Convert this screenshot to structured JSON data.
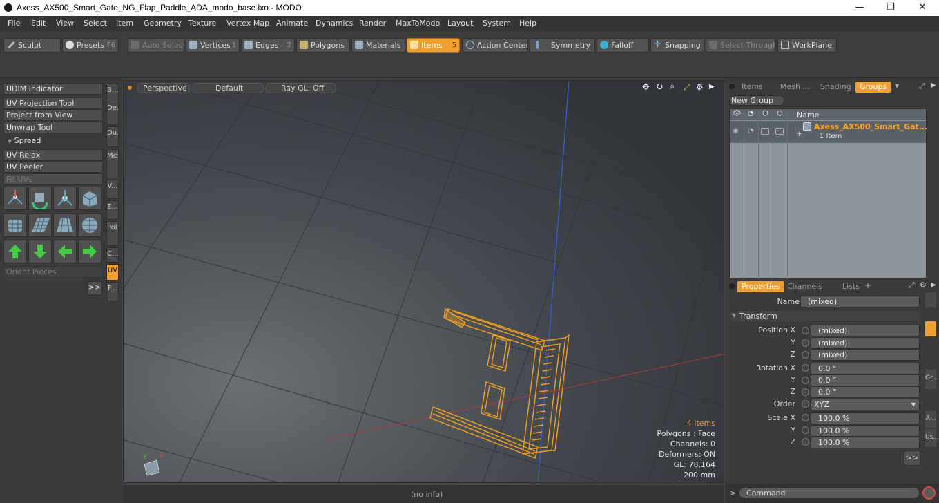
{
  "window": {
    "title": "Axess_AX500_Smart_Gate_NG_Flap_Paddle_ADA_modo_base.lxo - MODO",
    "minimize": "—",
    "maximize": "❐",
    "close": "✕"
  },
  "menu": [
    "File",
    "Edit",
    "View",
    "Select",
    "Item",
    "Geometry",
    "Texture",
    "Vertex Map",
    "Animate",
    "Dynamics",
    "Render",
    "MaxToModo",
    "Layout",
    "System",
    "Help"
  ],
  "toolbar": {
    "sculpt": "Sculpt",
    "presets": "Presets",
    "presets_key": "F6",
    "auto_select": "Auto Select",
    "vertices": "Vertices",
    "vertices_num": "1",
    "edges": "Edges",
    "edges_num": "2",
    "polygons": "Polygons",
    "materials": "Materials",
    "items": "Items",
    "items_num": "5",
    "action_center": "Action Center",
    "symmetry": "Symmetry",
    "falloff": "Falloff",
    "snapping": "Snapping",
    "select_through": "Select Through",
    "workplane": "WorkPlane"
  },
  "left_panel": {
    "buttons": [
      "UDIM Indicator",
      "UV Projection Tool",
      "Project from View",
      "Unwrap Tool",
      "Spread",
      "UV Relax",
      "UV Peeler",
      "Fit UVs"
    ],
    "orient_pieces": "Orient Pieces",
    "more": ">>",
    "vtabs": [
      "B...",
      "De...",
      "Du...",
      "Mes...",
      "V...",
      "E...",
      "Pol...",
      "C...",
      "UV",
      "F..."
    ]
  },
  "viewport": {
    "perspective": "Perspective",
    "shading": "Default",
    "raygl": "Ray GL: Off",
    "stats": {
      "items": "4 Items",
      "polygons": "Polygons : Face",
      "channels": "Channels: 0",
      "deformers": "Deformers: ON",
      "gl": "GL: 78,164",
      "size": "200 mm"
    }
  },
  "status": {
    "info": "(no info)"
  },
  "groups_panel": {
    "tabs": [
      "Items",
      "Mesh ...",
      "Shading",
      "Groups"
    ],
    "new_group": "New Group",
    "col_name": "Name",
    "group_name": "Axess_AX500_Smart_Gat...",
    "group_count": "1 Item"
  },
  "properties": {
    "tabs": [
      "Properties",
      "Channels",
      "Lists"
    ],
    "add": "+",
    "name_label": "Name",
    "name_value": "(mixed)",
    "transform_label": "Transform",
    "position_label": "Position X",
    "pos_x": "(mixed)",
    "pos_y": "(mixed)",
    "pos_z": "(mixed)",
    "rotation_label": "Rotation X",
    "rot_x": "0.0 °",
    "rot_y": "0.0 °",
    "rot_z": "0.0 °",
    "order_label": "Order",
    "order_value": "XYZ",
    "scale_label": "Scale X",
    "scale_x": "100.0 %",
    "scale_y": "100.0 %",
    "scale_z": "100.0 %",
    "y_label": "Y",
    "z_label": "Z",
    "more": ">>",
    "side_tabs": [
      "Gr...",
      "A...",
      "Us..."
    ]
  },
  "command": {
    "prompt": ">",
    "placeholder": "Command"
  }
}
